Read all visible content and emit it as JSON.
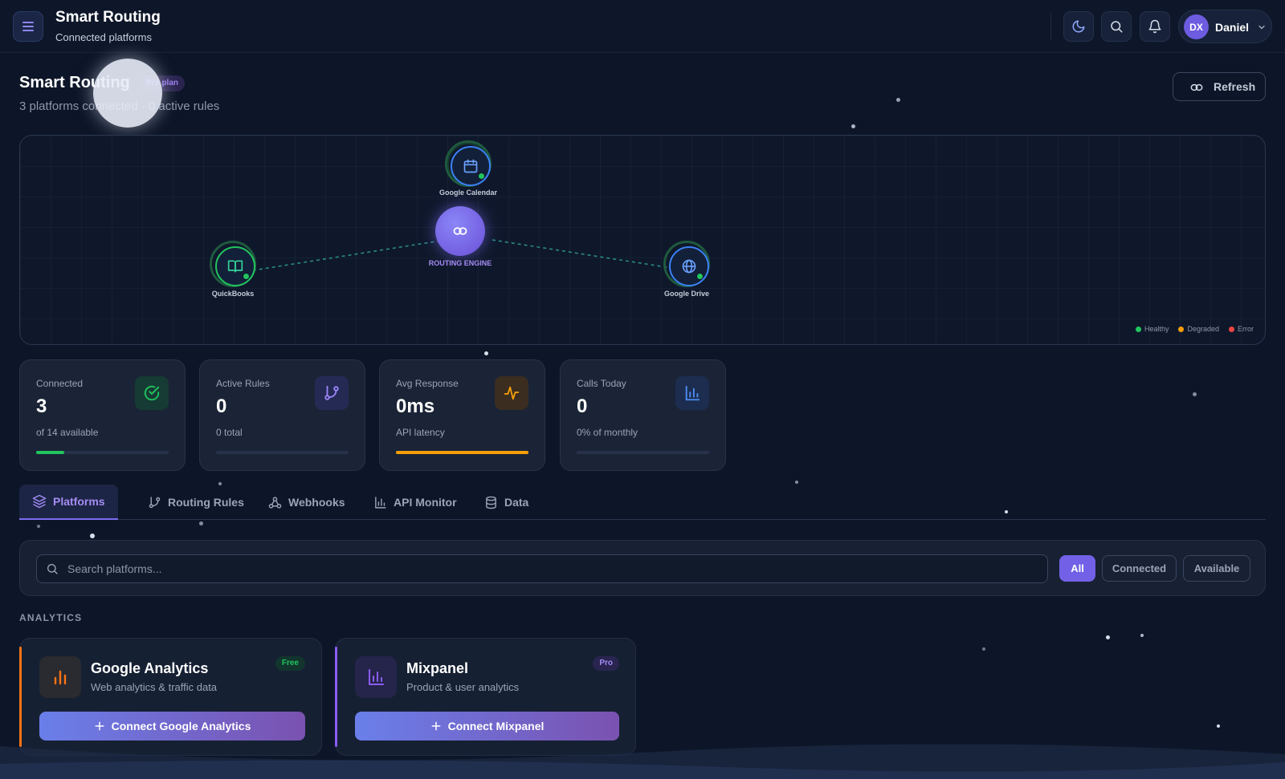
{
  "header": {
    "title": "Smart Routing",
    "subtitle": "Connected platforms",
    "user": {
      "initials": "DX",
      "name": "Daniel"
    }
  },
  "page": {
    "title": "Smart Routing",
    "plan_badge": "Pro plan",
    "summary": "3 platforms connected · 0 active rules",
    "refresh_label": "Refresh"
  },
  "topology": {
    "engine_label": "ROUTING ENGINE",
    "nodes": [
      {
        "name": "Google Calendar",
        "status": "Healthy"
      },
      {
        "name": "QuickBooks",
        "status": "Healthy"
      },
      {
        "name": "Google Drive",
        "status": "Healthy"
      }
    ],
    "legend": [
      {
        "label": "Healthy",
        "color": "#22c55e"
      },
      {
        "label": "Degraded",
        "color": "#f59e0b"
      },
      {
        "label": "Error",
        "color": "#ef4444"
      }
    ]
  },
  "stats": [
    {
      "label": "Connected",
      "value": "3",
      "sub": "of 14 available",
      "icon": "check-circle-icon",
      "progress": 0.21,
      "color": "#22c55e"
    },
    {
      "label": "Active Rules",
      "value": "0",
      "sub": "0 total",
      "icon": "git-branch-icon",
      "progress": 0,
      "color": "#8b7cf6"
    },
    {
      "label": "Avg Response",
      "value": "0ms",
      "sub": "API latency",
      "icon": "activity-icon",
      "progress": 1.0,
      "color": "#f59e0b"
    },
    {
      "label": "Calls Today",
      "value": "0",
      "sub": "0% of monthly",
      "icon": "bar-chart-icon",
      "progress": 0,
      "color": "#3b82f6"
    }
  ],
  "tabs": [
    {
      "label": "Platforms",
      "icon": "layers-icon",
      "active": true
    },
    {
      "label": "Routing Rules",
      "icon": "git-branch-icon",
      "active": false
    },
    {
      "label": "Webhooks",
      "icon": "webhook-icon",
      "active": false
    },
    {
      "label": "API Monitor",
      "icon": "bar-chart-icon",
      "active": false
    },
    {
      "label": "Data",
      "icon": "database-icon",
      "active": false
    }
  ],
  "search": {
    "placeholder": "Search platforms..."
  },
  "filters": [
    {
      "label": "All",
      "active": true
    },
    {
      "label": "Connected",
      "active": false
    },
    {
      "label": "Available",
      "active": false
    }
  ],
  "sections": [
    {
      "title": "ANALYTICS",
      "platforms": [
        {
          "name": "Google Analytics",
          "description": "Web analytics & traffic data",
          "tier": "Free",
          "action": "Connect Google Analytics",
          "accent": "#f97316"
        },
        {
          "name": "Mixpanel",
          "description": "Product & user analytics",
          "tier": "Pro",
          "action": "Connect Mixpanel",
          "accent": "#8b5cf6"
        }
      ]
    }
  ]
}
